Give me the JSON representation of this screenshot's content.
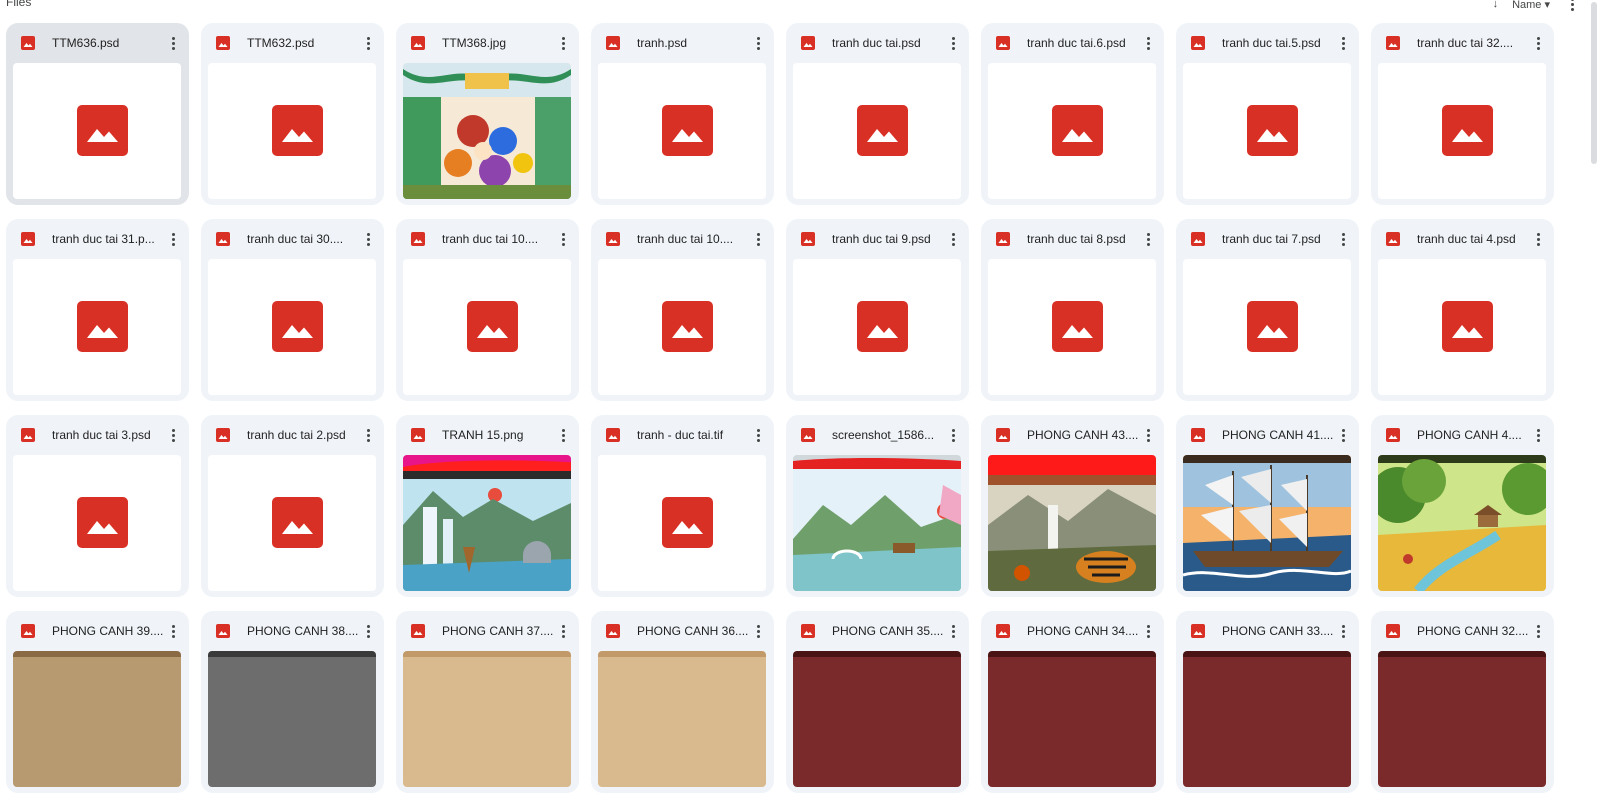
{
  "header": {
    "section_title": "Files",
    "sort_label": "Name",
    "sort_arrow": "↓",
    "sort_caret": "▾"
  },
  "colors": {
    "file_icon_red": "#d93025",
    "tile_bg": "#f0f4f9",
    "selected_tile_bg": "#e1e4e8"
  },
  "icons": {
    "file_type": "image-file-icon",
    "more_actions": "more-vert-icon",
    "placeholder": "image-placeholder-icon"
  },
  "files": [
    {
      "name": "TTM636.psd",
      "thumb": "placeholder",
      "selected": true
    },
    {
      "name": "TTM632.psd",
      "thumb": "placeholder"
    },
    {
      "name": "TTM368.jpg",
      "thumb": "dragon-painting"
    },
    {
      "name": "tranh.psd",
      "thumb": "placeholder"
    },
    {
      "name": "tranh duc tai.psd",
      "thumb": "placeholder"
    },
    {
      "name": "tranh duc tai.6.psd",
      "thumb": "placeholder"
    },
    {
      "name": "tranh duc tai.5.psd",
      "thumb": "placeholder"
    },
    {
      "name": "tranh duc tai 32....",
      "thumb": "placeholder"
    },
    {
      "name": "tranh duc tai 31.p...",
      "thumb": "placeholder"
    },
    {
      "name": "tranh duc tai 30....",
      "thumb": "placeholder"
    },
    {
      "name": "tranh duc tai 10....",
      "thumb": "placeholder"
    },
    {
      "name": "tranh duc tai 10....",
      "thumb": "placeholder"
    },
    {
      "name": "tranh duc tai 9.psd",
      "thumb": "placeholder"
    },
    {
      "name": "tranh duc tai 8.psd",
      "thumb": "placeholder"
    },
    {
      "name": "tranh duc tai 7.psd",
      "thumb": "placeholder"
    },
    {
      "name": "tranh duc tai 4.psd",
      "thumb": "placeholder"
    },
    {
      "name": "tranh duc tai 3.psd",
      "thumb": "placeholder"
    },
    {
      "name": "tranh duc tai 2.psd",
      "thumb": "placeholder"
    },
    {
      "name": "TRANH 15.png",
      "thumb": "waterfall-landscape"
    },
    {
      "name": "tranh - duc tai.tif",
      "thumb": "placeholder"
    },
    {
      "name": "screenshot_1586...",
      "thumb": "lake-landscape"
    },
    {
      "name": "PHONG CANH 43....",
      "thumb": "tiger-landscape"
    },
    {
      "name": "PHONG CANH 41....",
      "thumb": "sailing-ship"
    },
    {
      "name": "PHONG CANH 4....",
      "thumb": "countryside"
    },
    {
      "name": "PHONG CANH 39....",
      "thumb": "partial-brown"
    },
    {
      "name": "PHONG CANH 38....",
      "thumb": "partial-dark"
    },
    {
      "name": "PHONG CANH 37....",
      "thumb": "partial-tan"
    },
    {
      "name": "PHONG CANH 36....",
      "thumb": "partial-tan"
    },
    {
      "name": "PHONG CANH 35....",
      "thumb": "partial-maroon"
    },
    {
      "name": "PHONG CANH 34....",
      "thumb": "partial-maroon"
    },
    {
      "name": "PHONG CANH 33....",
      "thumb": "partial-maroon"
    },
    {
      "name": "PHONG CANH 32....",
      "thumb": "partial-maroon"
    }
  ]
}
